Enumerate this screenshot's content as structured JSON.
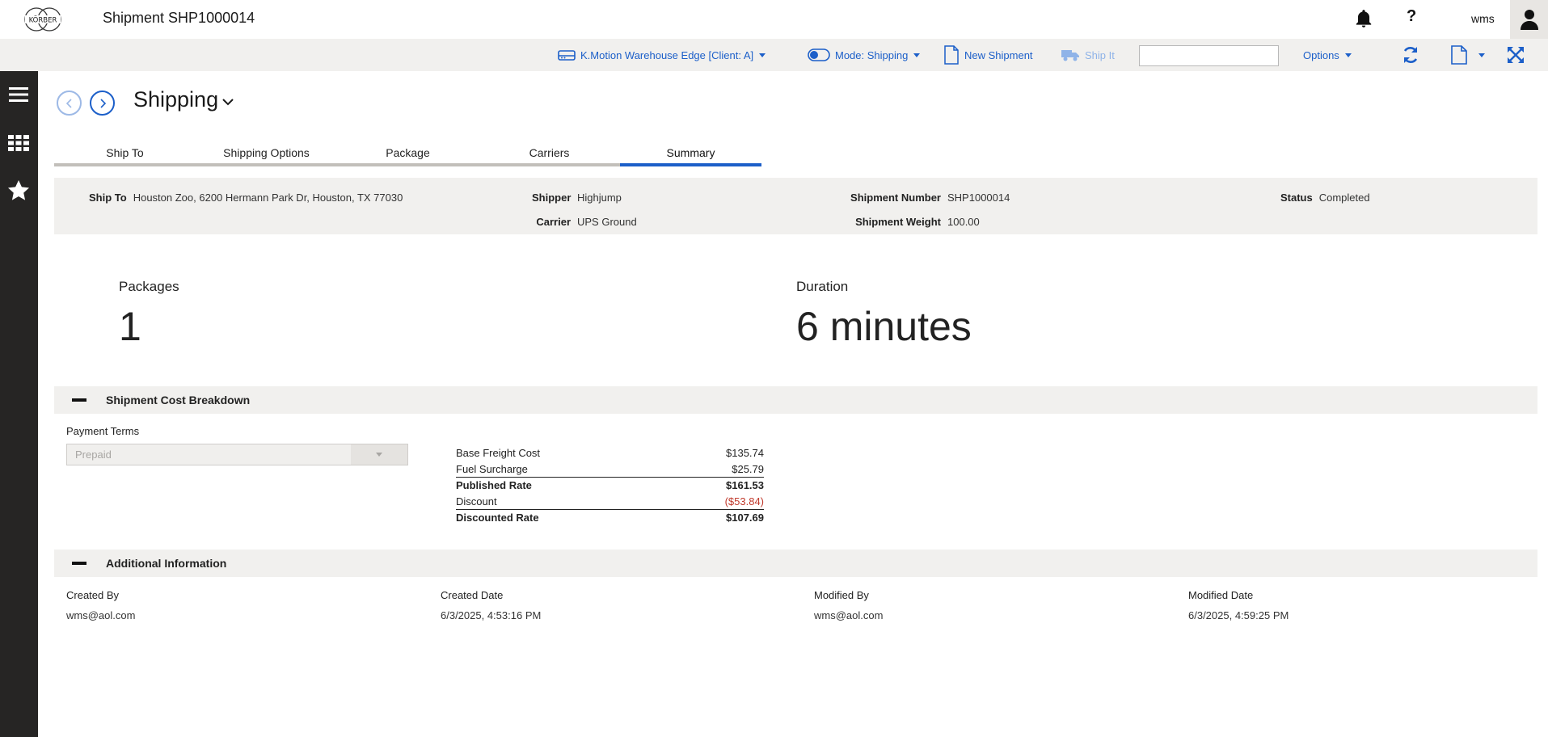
{
  "header": {
    "logo_text": "KÖRBER",
    "title": "Shipment SHP1000014",
    "user": "wms"
  },
  "toolbar": {
    "warehouse": "K.Motion Warehouse Edge [Client: A]",
    "mode": "Mode: Shipping",
    "new_shipment": "New Shipment",
    "ship_it": "Ship It",
    "search_value": "",
    "options": "Options"
  },
  "page": {
    "title": "Shipping",
    "tabs": [
      {
        "label": "Ship To",
        "active": false
      },
      {
        "label": "Shipping Options",
        "active": false
      },
      {
        "label": "Package",
        "active": false
      },
      {
        "label": "Carriers",
        "active": false
      },
      {
        "label": "Summary",
        "active": true
      }
    ]
  },
  "summary": {
    "ship_to_label": "Ship To",
    "ship_to": "Houston Zoo, 6200 Hermann Park Dr, Houston, TX 77030",
    "shipper_label": "Shipper",
    "shipper": "Highjump",
    "carrier_label": "Carrier",
    "carrier": "UPS Ground",
    "shipment_number_label": "Shipment Number",
    "shipment_number": "SHP1000014",
    "shipment_weight_label": "Shipment Weight",
    "shipment_weight": "100.00",
    "status_label": "Status",
    "status": "Completed"
  },
  "stats": {
    "packages_label": "Packages",
    "packages": "1",
    "duration_label": "Duration",
    "duration": "6 minutes"
  },
  "cost_breakdown": {
    "title": "Shipment Cost Breakdown",
    "payment_terms_label": "Payment Terms",
    "payment_terms": "Prepaid",
    "rows": [
      {
        "label": "Base Freight Cost",
        "value": "$135.74"
      },
      {
        "label": "Fuel Surcharge",
        "value": "$25.79"
      },
      {
        "label": "Published Rate",
        "value": "$161.53"
      },
      {
        "label": "Discount",
        "value": "($53.84)"
      },
      {
        "label": "Discounted Rate",
        "value": "$107.69"
      }
    ]
  },
  "additional": {
    "title": "Additional Information",
    "created_by_label": "Created By",
    "created_by": "wms@aol.com",
    "created_date_label": "Created Date",
    "created_date": "6/3/2025, 4:53:16 PM",
    "modified_by_label": "Modified By",
    "modified_by": "wms@aol.com",
    "modified_date_label": "Modified Date",
    "modified_date": "6/3/2025, 4:59:25 PM"
  },
  "colors": {
    "accent": "#1c5fc9",
    "rail": "#262524",
    "band": "#f1f0ee",
    "negative": "#c0392b"
  },
  "icons": {
    "logo": "korber-logo",
    "bell": "bell-icon",
    "help": "help-icon",
    "user": "user-icon",
    "warehouse": "warehouse-icon",
    "toggle": "toggle-icon",
    "document": "document-icon",
    "truck": "truck-icon",
    "refresh": "refresh-icon",
    "file": "file-icon",
    "fullscreen": "fullscreen-icon",
    "menu": "menu-icon",
    "apps": "apps-grid-icon",
    "favorites": "star-icon"
  }
}
